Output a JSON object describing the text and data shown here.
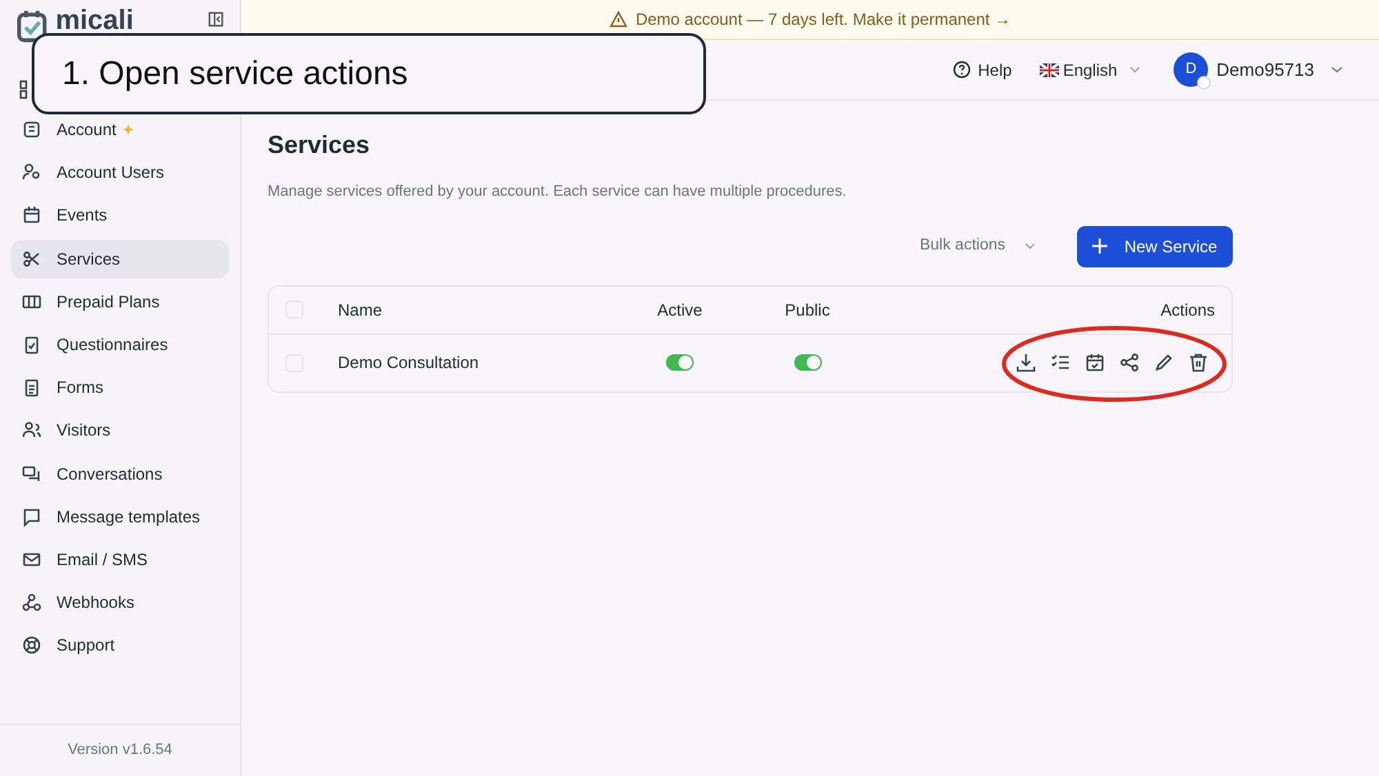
{
  "logo": {
    "name": "micali"
  },
  "banner": {
    "text": "Demo account — 7 days left. Make it permanent →"
  },
  "header": {
    "help": "Help",
    "language": "English",
    "user": {
      "initial": "D",
      "name": "Demo95713"
    }
  },
  "sidebar": {
    "items": [
      {
        "kind": "account",
        "label": "Account",
        "selected": false,
        "badge": true
      },
      {
        "kind": "users",
        "label": "Account Users",
        "selected": false
      },
      {
        "kind": "events",
        "label": "Events",
        "selected": false
      },
      {
        "kind": "services",
        "label": "Services",
        "selected": true
      },
      {
        "kind": "plans",
        "label": "Prepaid Plans",
        "selected": false
      },
      {
        "kind": "questionnaires",
        "label": "Questionnaires",
        "selected": false
      },
      {
        "kind": "forms",
        "label": "Forms",
        "selected": false
      },
      {
        "kind": "visitors",
        "label": "Visitors",
        "selected": false
      },
      {
        "kind": "conversations",
        "label": "Conversations",
        "selected": false
      },
      {
        "kind": "templates",
        "label": "Message templates",
        "selected": false
      },
      {
        "kind": "email",
        "label": "Email / SMS",
        "selected": false
      },
      {
        "kind": "webhooks",
        "label": "Webhooks",
        "selected": false
      },
      {
        "kind": "support",
        "label": "Support",
        "selected": false
      }
    ],
    "version": "Version v1.6.54"
  },
  "page": {
    "title": "Services",
    "description": "Manage services offered by your account. Each service can have multiple procedures.",
    "bulk_actions": "Bulk actions",
    "new_button": "New Service"
  },
  "table": {
    "all_checked": false,
    "columns": [
      "Name",
      "Active",
      "Public",
      "Actions"
    ],
    "rows": [
      {
        "name": "Demo Consultation",
        "checked": false,
        "active": true,
        "public": true
      }
    ]
  },
  "callout": {
    "text": "1. Open service actions"
  }
}
